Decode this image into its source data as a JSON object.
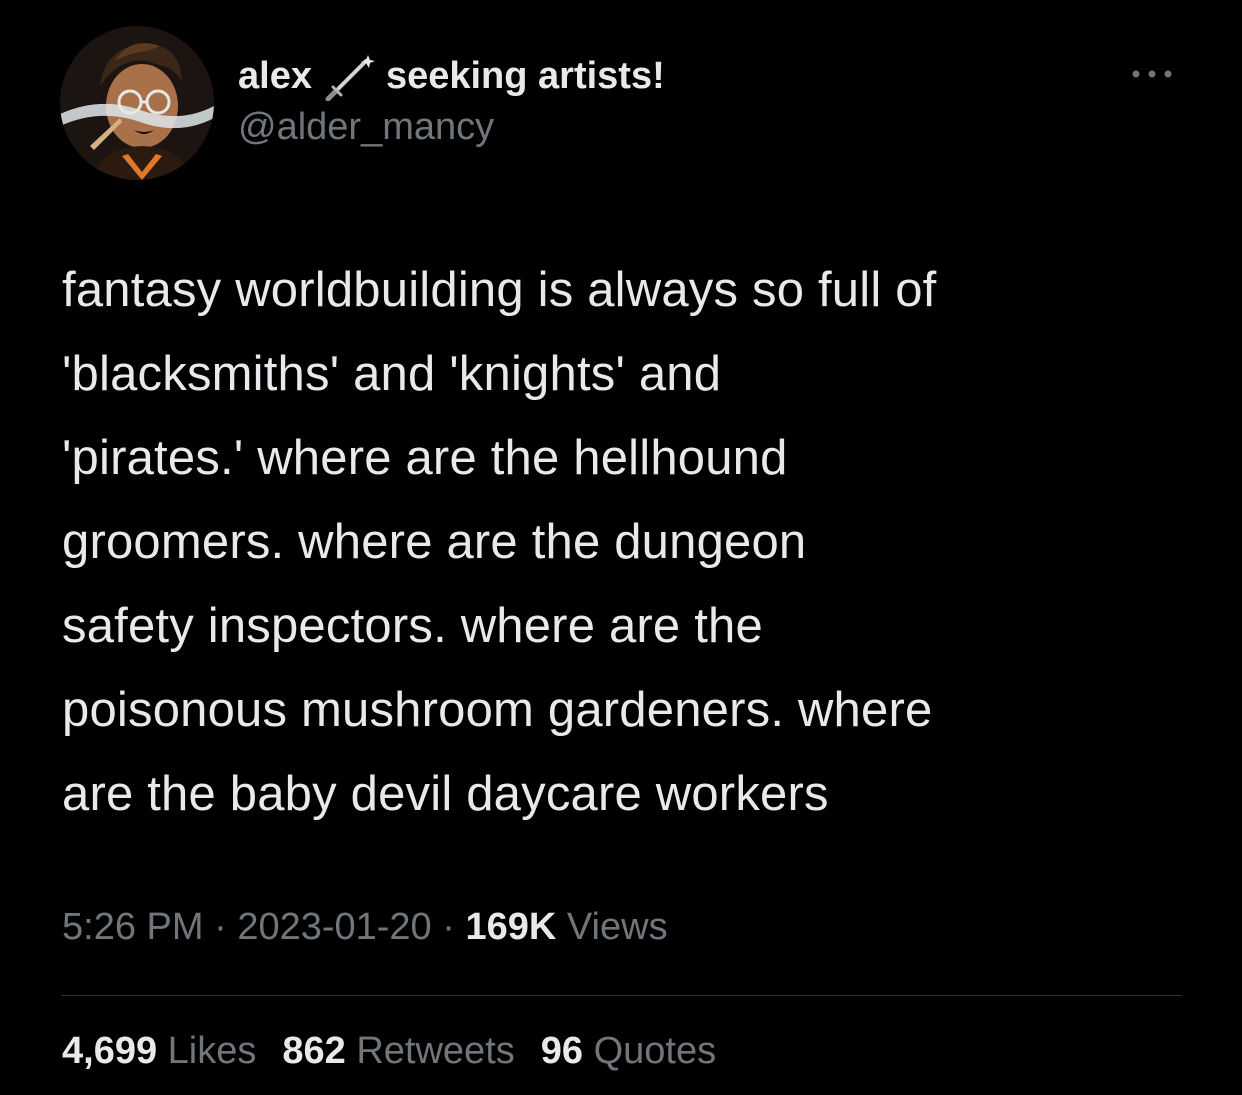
{
  "author": {
    "display_name": "alex",
    "name_suffix": "seeking artists!",
    "handle": "@alder_mancy",
    "avatar_icon": "avatar-illustration",
    "name_icon": "dagger-icon"
  },
  "tweet": {
    "lines": [
      "fantasy worldbuilding is always so full of",
      "'blacksmiths' and 'knights' and",
      "'pirates.' where are the hellhound",
      "groomers. where are the dungeon",
      "safety inspectors. where are the",
      "poisonous mushroom gardeners. where",
      "are the baby devil daycare workers"
    ]
  },
  "meta": {
    "time": "5:26 PM",
    "separator": "·",
    "date": "2023-01-20",
    "views_count": "169K",
    "views_label": "Views"
  },
  "stats": {
    "likes_count": "4,699",
    "likes_label": "Likes",
    "retweets_count": "862",
    "retweets_label": "Retweets",
    "quotes_count": "96",
    "quotes_label": "Quotes"
  },
  "colors": {
    "background": "#000000",
    "primary_text": "#e7e9ea",
    "secondary_text": "#71767b",
    "divider": "#2f3336"
  }
}
